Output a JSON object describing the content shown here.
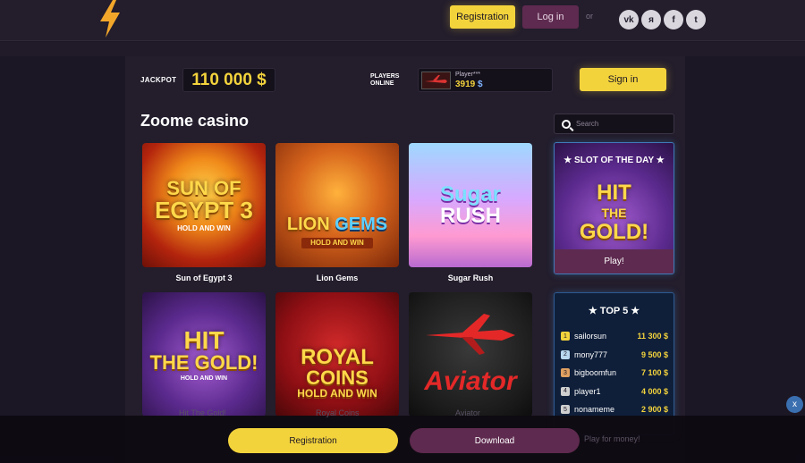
{
  "header": {
    "registration_label": "Registration",
    "login_label": "Log in",
    "or_text": "or",
    "social": [
      {
        "icon": "vk-icon",
        "glyph": "vk"
      },
      {
        "icon": "yandex-icon",
        "glyph": "я"
      },
      {
        "icon": "facebook-icon",
        "glyph": "f"
      },
      {
        "icon": "twitter-icon",
        "glyph": "t"
      }
    ]
  },
  "jackpot": {
    "label": "JACKPOT",
    "amount": "110 000 $"
  },
  "players": {
    "label_line1": "PLAYERS",
    "label_line2": "ONLINE",
    "player_name": "Player***",
    "count": "3919",
    "currency": "$"
  },
  "signin_label": "Sign in",
  "section_title": "Zoome casino",
  "search": {
    "placeholder": "Search"
  },
  "games": [
    {
      "name": "Sun of Egypt 3",
      "art_line1": "SUN OF",
      "art_line2": "EGYPT 3",
      "art_sub": "HOLD AND WIN"
    },
    {
      "name": "Lion Gems",
      "art_line1": "LION",
      "art_line2": "GEMS",
      "art_sub": "HOLD AND WIN"
    },
    {
      "name": "Sugar Rush",
      "art_line1": "Sugar",
      "art_line2": "RUSH",
      "art_sub": ""
    },
    {
      "name": "Hit The Gold!",
      "art_line1": "HIT",
      "art_line2": "THE GOLD!",
      "art_sub": "HOLD AND WIN"
    },
    {
      "name": "Royal Coins",
      "art_line1": "ROYAL",
      "art_line2": "COINS",
      "art_sub": "HOLD AND WIN"
    },
    {
      "name": "Aviator",
      "art_line1": "Aviator",
      "art_line2": "",
      "art_sub": ""
    }
  ],
  "slot_of_day": {
    "title": "★ SLOT OF THE DAY ★",
    "art_line1": "HIT",
    "art_line2": "THE",
    "art_line3": "GOLD!",
    "play_label": "Play!"
  },
  "top5": {
    "title": "★ TOP 5 ★",
    "rows": [
      {
        "rank": "1",
        "name": "sailorsun",
        "amount": "11 300 $",
        "badge_color": "#f3d33c"
      },
      {
        "rank": "2",
        "name": "mony777",
        "amount": "9 500 $",
        "badge_color": "#b9d8f0"
      },
      {
        "rank": "3",
        "name": "bigboomfun",
        "amount": "7 100 $",
        "badge_color": "#e0a060"
      },
      {
        "rank": "4",
        "name": "player1",
        "amount": "4 000 $",
        "badge_color": "#cfcfcf"
      },
      {
        "rank": "5",
        "name": "nonameme",
        "amount": "2 900 $",
        "badge_color": "#cfcfcf"
      }
    ]
  },
  "bottom_bar": {
    "registration_label": "Registration",
    "download_label": "Download",
    "faded_play_money": "Play for money!",
    "faded_hit_gold": "Hit The Gold!",
    "faded_royal": "Royal Coins",
    "faded_aviator": "Aviator",
    "close_label": "x"
  },
  "colors": {
    "accent_yellow": "#f3d33c",
    "accent_plum": "#5e2a4f",
    "background": "#1c1724",
    "panel": "#231d2c"
  }
}
